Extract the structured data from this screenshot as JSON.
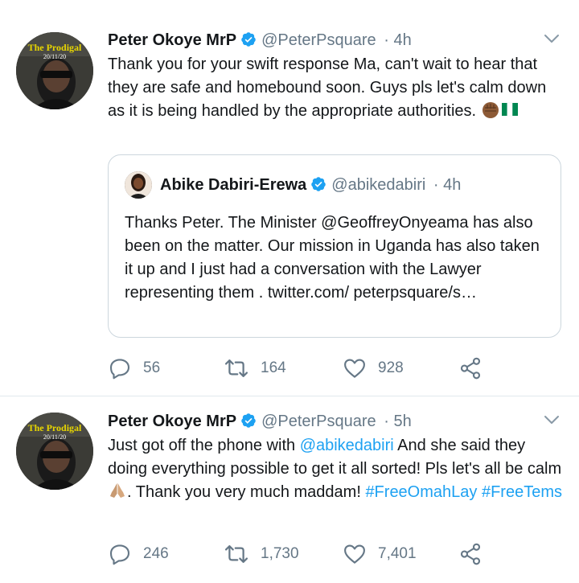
{
  "tweets": [
    {
      "avatar_caption": "The Prodigal",
      "avatar_date": "20/11/20",
      "name": "Peter Okoye MrP",
      "handle": "@PeterPsquare",
      "time": "· 4h",
      "text": "Thank you for your swift response Ma, can't wait to hear that they are safe and homebound soon. Guys pls let's calm down as it is being handled by the appropriate authorities.",
      "quote": {
        "name": "Abike Dabiri-Erewa",
        "handle": "@abikedabiri",
        "time": "· 4h",
        "text": "Thanks Peter. The Minister @GeoffreyOnyeama has also been on the matter. Our mission in Uganda has also taken it up and I just had a conversation with the Lawyer representing them . twitter.com/ peterpsquare/s…"
      },
      "replies": "56",
      "retweets": "164",
      "likes": "928"
    },
    {
      "avatar_caption": "The Prodigal",
      "avatar_date": "20/11/20",
      "name": "Peter Okoye MrP",
      "handle": "@PeterPsquare",
      "time": "· 5h",
      "text_part1": "Just got off the phone with",
      "mention": "@abikedabiri",
      "text_part2": "And she said they doing everything possible to get it all sorted! Pls let's all be calm",
      "text_part3": ". Thank you very much maddam!",
      "hashtag1": "#FreeOmahLay",
      "hashtag2": "#FreeTems",
      "replies": "246",
      "retweets": "1,730",
      "likes": "7,401"
    }
  ],
  "colors": {
    "link": "#1da1f2",
    "muted": "#657786",
    "verified": "#1da1f2",
    "border": "#e1e8ed"
  },
  "icons": [
    "verified-badge-icon",
    "chevron-down-icon",
    "reply-icon",
    "retweet-icon",
    "like-icon",
    "share-icon",
    "raised-fist-emoji",
    "nigeria-flag-emoji",
    "folded-hands-emoji"
  ]
}
